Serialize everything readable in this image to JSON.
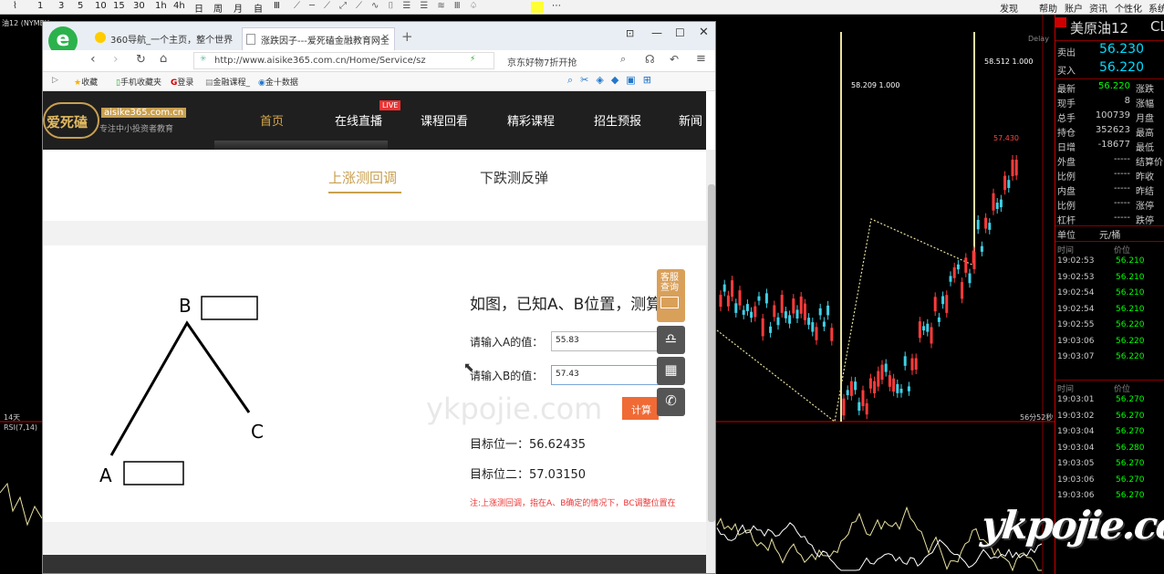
{
  "toolbar": {
    "items": [
      "1",
      "3",
      "5",
      "10",
      "15",
      "30",
      "1h",
      "4h",
      "日",
      "周",
      "月",
      "自",
      "Ⅲ"
    ],
    "right": [
      "发现",
      "帮助",
      "账户",
      "资讯",
      "个性化",
      "系统"
    ]
  },
  "chart": {
    "left_label": "油12 (NYMEX",
    "lines": [
      {
        "label": "58.209 1.000"
      },
      {
        "label": "58.512 1.000"
      }
    ],
    "high_label": "57.430",
    "delay": "Delay",
    "period_label": "14天",
    "rsi_label": "RSI(7,14)",
    "time_label": "56分52秒"
  },
  "quote": {
    "title": "美原油12",
    "code": "CL",
    "sell_label": "卖出",
    "sell": "56.230",
    "buy_label": "买入",
    "buy": "56.220",
    "stats": [
      {
        "l": "最新",
        "v": "56.220",
        "r": "涨跌"
      },
      {
        "l": "现手",
        "v": "8",
        "r": "涨幅"
      },
      {
        "l": "总手",
        "v": "100739",
        "r": "月盘"
      },
      {
        "l": "持仓",
        "v": "352623",
        "r": "最高"
      },
      {
        "l": "日增",
        "v": "-18677",
        "r": "最低"
      },
      {
        "l": "外盘",
        "v": "-----",
        "r": "结算价"
      },
      {
        "l": "比例",
        "v": "-----",
        "r": "昨收"
      },
      {
        "l": "内盘",
        "v": "-----",
        "r": "昨结"
      },
      {
        "l": "比例",
        "v": "-----",
        "r": "涨停"
      },
      {
        "l": "杠杆",
        "v": "-----",
        "r": "跌停"
      }
    ],
    "unit_label": "单位",
    "unit": "元/桶",
    "col_time": "时间",
    "col_price": "价位",
    "ticks1": [
      {
        "t": "19:02:53",
        "p": "56.210"
      },
      {
        "t": "19:02:53",
        "p": "56.210"
      },
      {
        "t": "19:02:54",
        "p": "56.210"
      },
      {
        "t": "19:02:54",
        "p": "56.210"
      },
      {
        "t": "19:02:55",
        "p": "56.220"
      },
      {
        "t": "19:03:06",
        "p": "56.220"
      },
      {
        "t": "19:03:07",
        "p": "56.220"
      }
    ],
    "ticks2": [
      {
        "t": "19:03:01",
        "p": "56.270"
      },
      {
        "t": "19:03:02",
        "p": "56.270"
      },
      {
        "t": "19:03:04",
        "p": "56.270"
      },
      {
        "t": "19:03:04",
        "p": "56.280"
      },
      {
        "t": "19:03:05",
        "p": "56.270"
      },
      {
        "t": "19:03:06",
        "p": "56.270"
      },
      {
        "t": "19:03:06",
        "p": "56.270"
      }
    ]
  },
  "browser": {
    "tab1": "360导航_一个主页，整个世界",
    "tab2": "涨跌因子---爱死磕金融教育网全",
    "url": "http://www.aisike365.com.cn/Home/Service/sz",
    "search": "京东好物7折开抢",
    "favs": [
      "收藏",
      "手机收藏夹",
      "登录",
      "金融课程_",
      "金十数据"
    ]
  },
  "site": {
    "logo": "爱死磕",
    "domain": "aisike365.com.cn",
    "slogan": "专注中小投资者教育",
    "nav": [
      "首页",
      "在线直播",
      "课程回看",
      "精彩课程",
      "招生预报",
      "新闻"
    ],
    "live": "LIVE",
    "subtabs": [
      "上涨测回调",
      "下跌测反弹"
    ],
    "diagram": {
      "a": "A",
      "b": "B",
      "c": "C"
    },
    "title": "如图，已知A、B位置，测算C",
    "a_label": "请输入A的值：",
    "a_value": "55.83",
    "b_label": "请输入B的值：",
    "b_value": "57.43",
    "calc": "计算",
    "target1": "目标位一：56.62435",
    "target2": "目标位二：57.03150",
    "note": "注:上涨测回调，指在A、B确定的情况下，BC调整位置在",
    "watermark": "ykpojie.com",
    "service": "客服查询"
  }
}
